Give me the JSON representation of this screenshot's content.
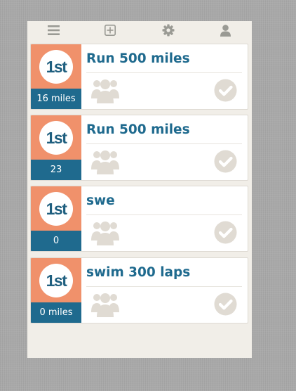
{
  "toolbar": {
    "items": [
      {
        "icon": "menu-icon"
      },
      {
        "icon": "add-square-icon"
      },
      {
        "icon": "gear-icon"
      },
      {
        "icon": "user-icon"
      }
    ]
  },
  "colors": {
    "badge": "#f0916b",
    "badge_footer": "#1f6a8e",
    "title": "#1f6a8e",
    "icon_muted": "#e0dbd3"
  },
  "challenges": [
    {
      "rank": "1st",
      "distance": "16 miles",
      "title": "Run 500 miles",
      "completed_icon": "check-circle-icon",
      "group_icon": "group-icon"
    },
    {
      "rank": "1st",
      "distance": "23",
      "title": "Run 500 miles",
      "completed_icon": "check-circle-icon",
      "group_icon": "group-icon"
    },
    {
      "rank": "1st",
      "distance": "0",
      "title": "swe",
      "completed_icon": "check-circle-icon",
      "group_icon": "group-icon"
    },
    {
      "rank": "1st",
      "distance": "0 miles",
      "title": "swim 300 laps",
      "completed_icon": "check-circle-icon",
      "group_icon": "group-icon"
    }
  ]
}
